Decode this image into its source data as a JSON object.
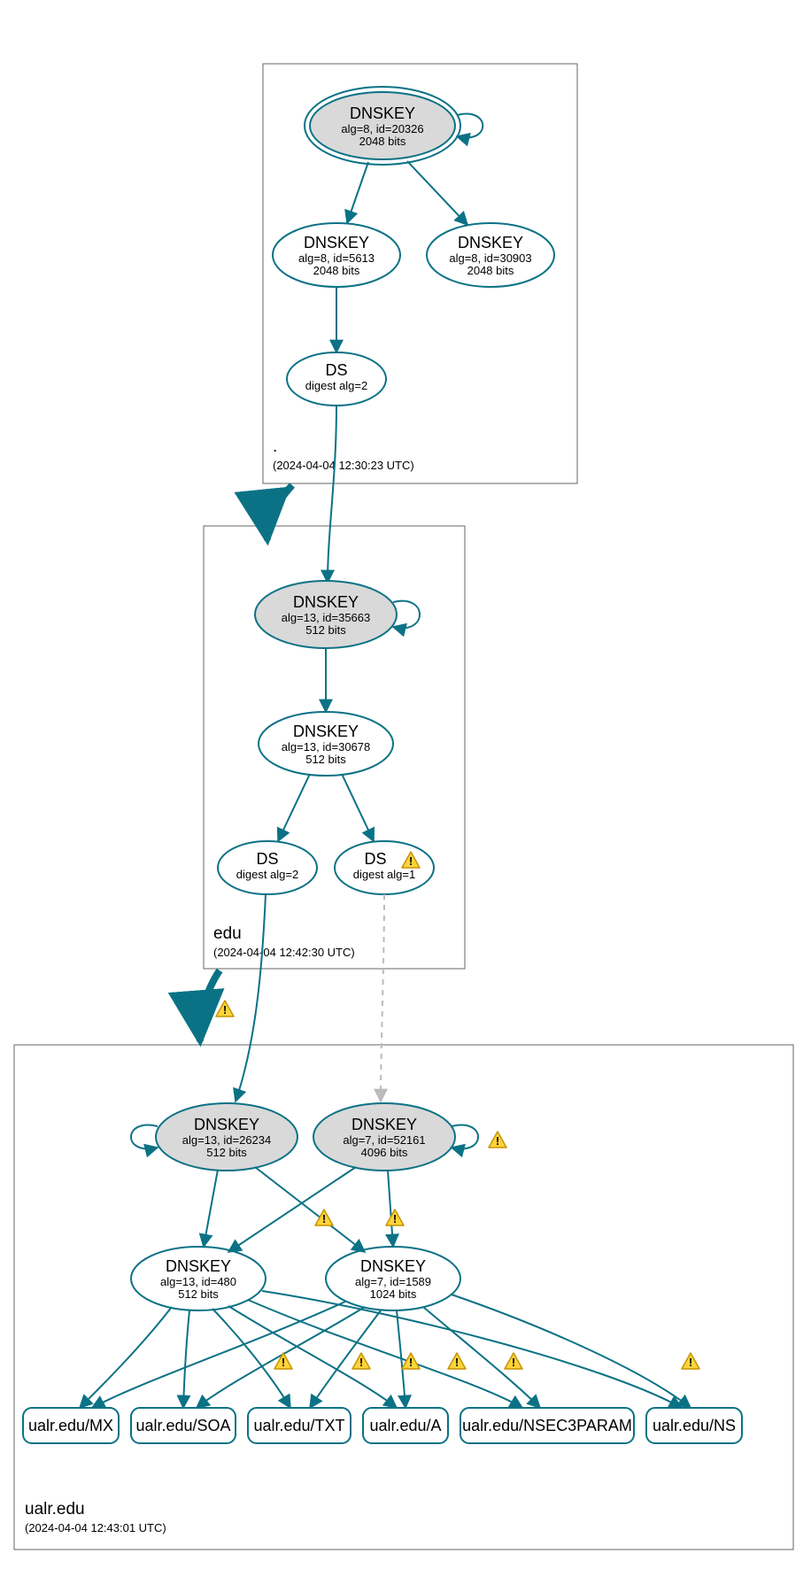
{
  "zones": {
    "root": {
      "label": ".",
      "timestamp": "(2024-04-04 12:30:23 UTC)"
    },
    "edu": {
      "label": "edu",
      "timestamp": "(2024-04-04 12:42:30 UTC)"
    },
    "ualr": {
      "label": "ualr.edu",
      "timestamp": "(2024-04-04 12:43:01 UTC)"
    }
  },
  "nodes": {
    "root_ksk": {
      "title": "DNSKEY",
      "line2": "alg=8, id=20326",
      "line3": "2048 bits"
    },
    "root_zsk1": {
      "title": "DNSKEY",
      "line2": "alg=8, id=5613",
      "line3": "2048 bits"
    },
    "root_zsk2": {
      "title": "DNSKEY",
      "line2": "alg=8, id=30903",
      "line3": "2048 bits"
    },
    "root_ds": {
      "title": "DS",
      "line2": "digest alg=2"
    },
    "edu_ksk": {
      "title": "DNSKEY",
      "line2": "alg=13, id=35663",
      "line3": "512 bits"
    },
    "edu_zsk": {
      "title": "DNSKEY",
      "line2": "alg=13, id=30678",
      "line3": "512 bits"
    },
    "edu_ds1": {
      "title": "DS",
      "line2": "digest alg=2"
    },
    "edu_ds2": {
      "title": "DS",
      "line3_warn": true,
      "line2": "digest alg=1"
    },
    "ualr_ksk1": {
      "title": "DNSKEY",
      "line2": "alg=13, id=26234",
      "line3": "512 bits"
    },
    "ualr_ksk2": {
      "title": "DNSKEY",
      "line2": "alg=7, id=52161",
      "line3": "4096 bits"
    },
    "ualr_zsk1": {
      "title": "DNSKEY",
      "line2": "alg=13, id=480",
      "line3": "512 bits"
    },
    "ualr_zsk2": {
      "title": "DNSKEY",
      "line2": "alg=7, id=1589",
      "line3": "1024 bits"
    },
    "rr_mx": {
      "label": "ualr.edu/MX"
    },
    "rr_soa": {
      "label": "ualr.edu/SOA"
    },
    "rr_txt": {
      "label": "ualr.edu/TXT"
    },
    "rr_a": {
      "label": "ualr.edu/A"
    },
    "rr_nsec": {
      "label": "ualr.edu/NSEC3PARAM"
    },
    "rr_ns": {
      "label": "ualr.edu/NS"
    }
  }
}
